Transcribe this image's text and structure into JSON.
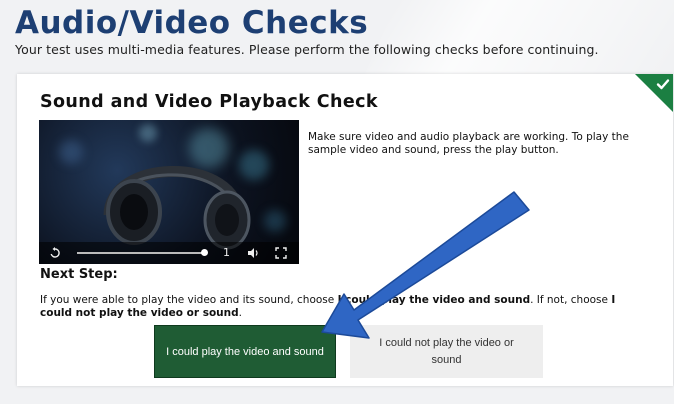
{
  "header": {
    "title": "Audio/Video Checks",
    "subtitle": "Your test uses multi-media features. Please perform the following checks before continuing."
  },
  "card": {
    "title": "Sound and Video Playback Check",
    "instructions": "Make sure video and audio playback are working. To play the sample video and sound, press the play button.",
    "next_step_label": "Next Step:",
    "choose_parts": {
      "p1": "If you were able to play the video and its sound, choose ",
      "p2": "I could play the video and sound",
      "p3": ". If not, choose ",
      "p4": "I could not play the video or sound",
      "p5": "."
    },
    "status_icon": "checkmark-icon",
    "status_color": "#1b7f42"
  },
  "video_player": {
    "speed_label": "1",
    "icons": [
      "replay-icon",
      "volume-icon",
      "fullscreen-icon"
    ]
  },
  "buttons": {
    "play_ok": "I could play the video and sound",
    "play_fail": "I could not play the video or sound"
  },
  "colors": {
    "title": "#1d3f73",
    "primary_button": "#1f5c34",
    "secondary_button": "#eeeeee",
    "arrow": "#2f66c4"
  }
}
